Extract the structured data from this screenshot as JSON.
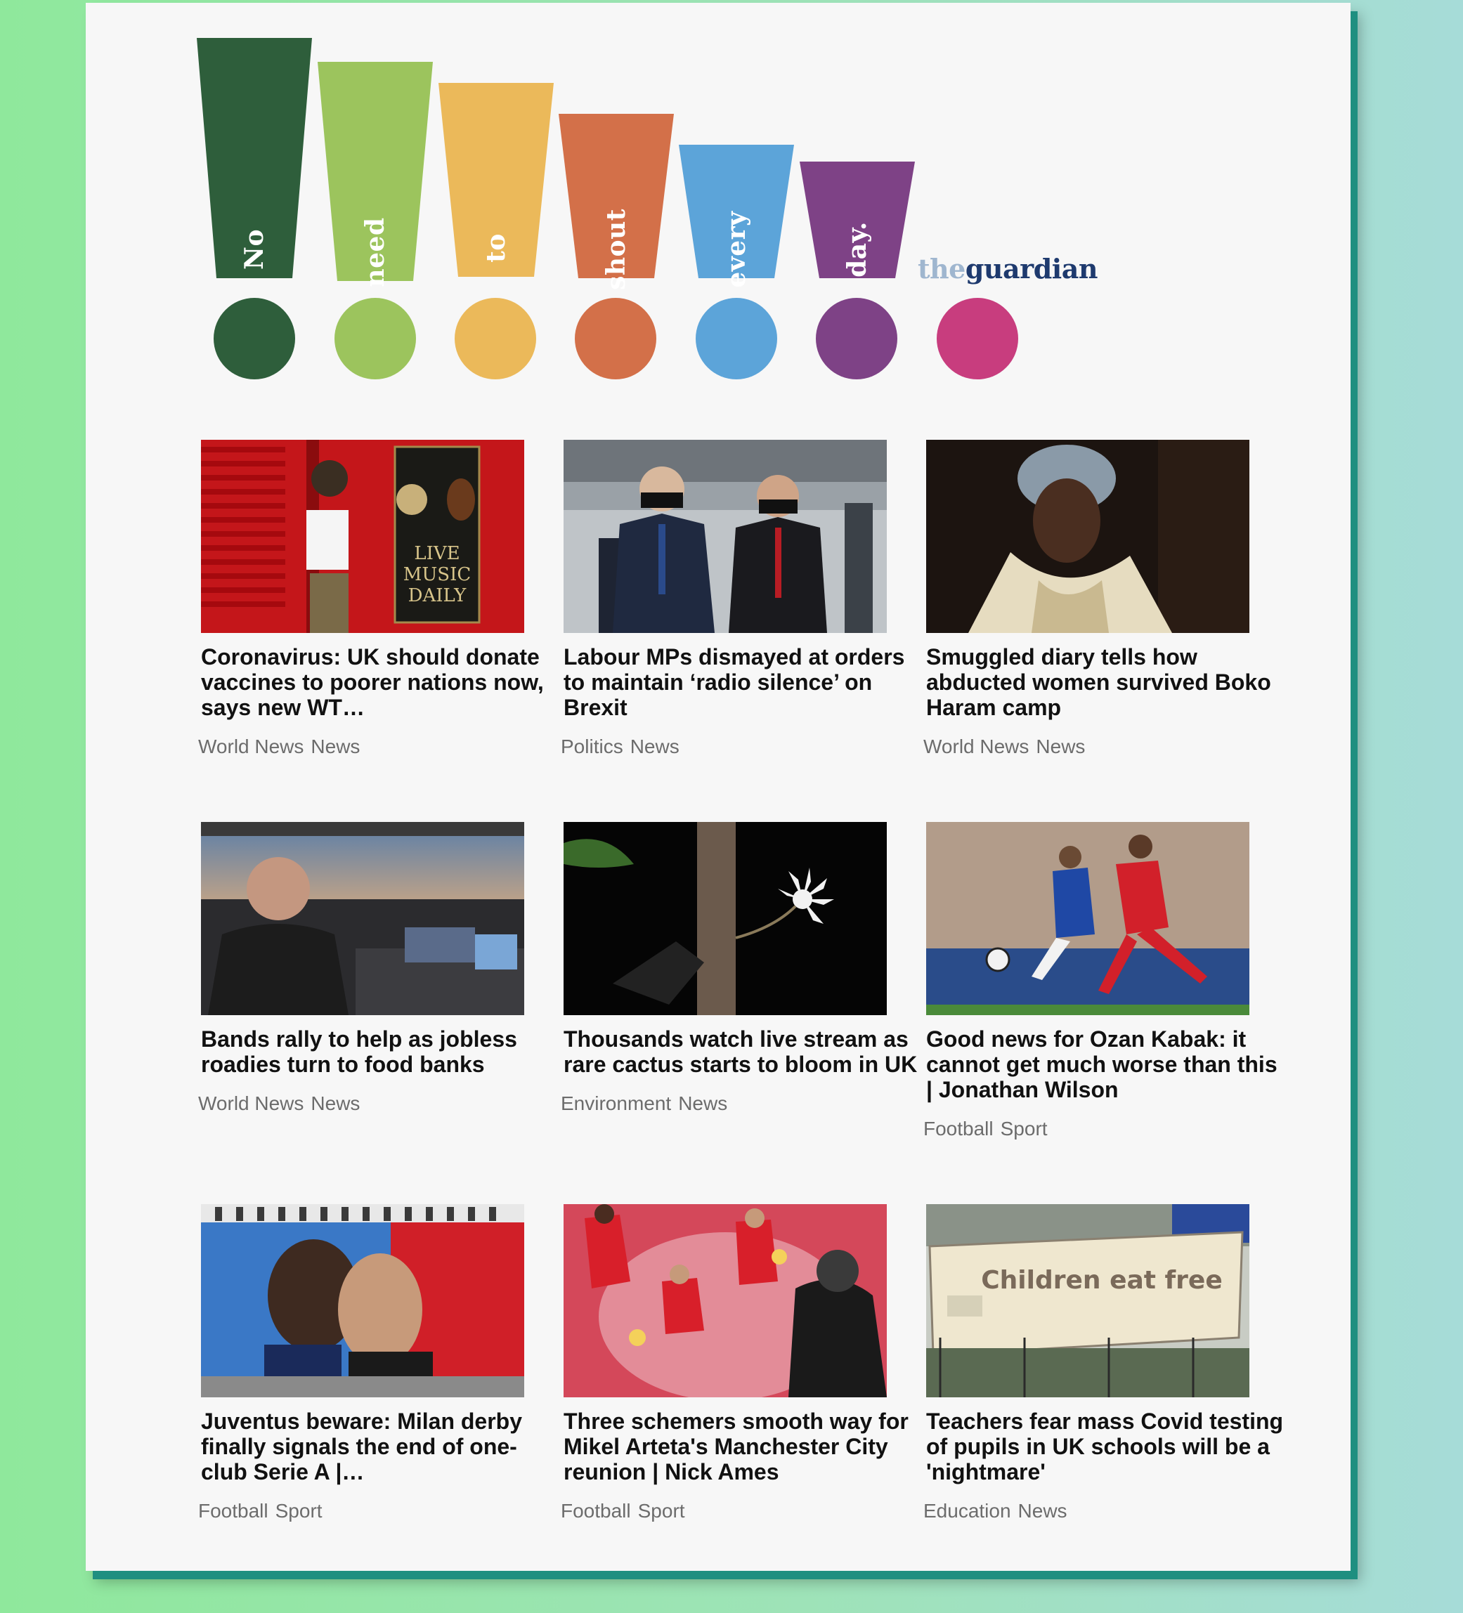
{
  "banner": {
    "words": [
      {
        "text": "No",
        "color": "#2e5e3b"
      },
      {
        "text": "need",
        "color": "#9cc45d"
      },
      {
        "text": "to",
        "color": "#ebb95a"
      },
      {
        "text": "shout",
        "color": "#d37049"
      },
      {
        "text": "every",
        "color": "#5ca4d9"
      },
      {
        "text": "day.",
        "color": "#7e4286"
      }
    ],
    "extra_dot_color": "#c83d7e",
    "logo": {
      "the": "the",
      "guardian": "guardian"
    }
  },
  "articles": [
    {
      "title": "Coronavirus: UK should donate vaccines to poorer nations now, says new WT…",
      "tag1": "World News",
      "tag2": "News"
    },
    {
      "title": "Labour MPs dismayed at orders to maintain ‘radio silence’ on Brexit",
      "tag1": "Politics",
      "tag2": "News"
    },
    {
      "title": "Smuggled diary tells how abducted women survived Boko Haram camp",
      "tag1": "World News",
      "tag2": "News"
    },
    {
      "title": "Bands rally to help as jobless roadies turn to food banks",
      "tag1": "World News",
      "tag2": "News"
    },
    {
      "title": "Thousands watch live stream as rare cactus starts to bloom in UK",
      "tag1": "Environment",
      "tag2": "News"
    },
    {
      "title": "Good news for Ozan Kabak: it cannot get much worse than this | Jonathan Wilson",
      "tag1": "Football",
      "tag2": "Sport"
    },
    {
      "title": "Juventus beware: Milan derby finally signals the end of one-club Serie A |…",
      "tag1": "Football",
      "tag2": "Sport"
    },
    {
      "title": "Three schemers smooth way for Mikel Arteta's Manchester City reunion | Nick Ames",
      "tag1": "Football",
      "tag2": "Sport"
    },
    {
      "title": "Teachers fear mass Covid testing of pupils in UK schools will be a 'nightmare'",
      "tag1": "Education",
      "tag2": "News"
    }
  ],
  "thumb_art": {
    "pub_sign": "LIVE MUSIC DAILY",
    "banner_text": "Children eat free"
  }
}
